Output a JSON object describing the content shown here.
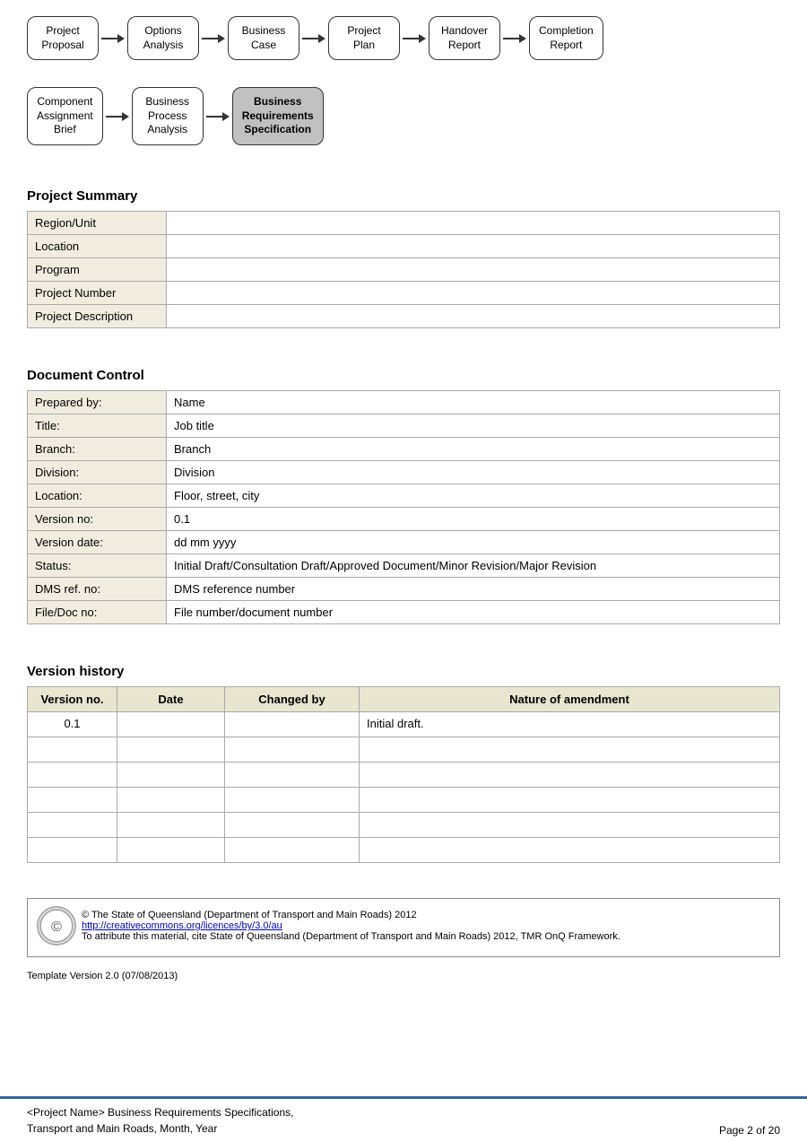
{
  "flow1": {
    "nodes": [
      {
        "label": "Project\nProposal",
        "active": false
      },
      {
        "label": "Options\nAnalysis",
        "active": false
      },
      {
        "label": "Business\nCase",
        "active": false
      },
      {
        "label": "Project\nPlan",
        "active": false
      },
      {
        "label": "Handover\nReport",
        "active": false
      },
      {
        "label": "Completion\nReport",
        "active": false
      }
    ]
  },
  "flow2": {
    "nodes": [
      {
        "label": "Component\nAssignment\nBrief",
        "active": false
      },
      {
        "label": "Business\nProcess\nAnalysis",
        "active": false
      },
      {
        "label": "Business\nRequirements\nSpecification",
        "active": true
      }
    ]
  },
  "projectSummary": {
    "title": "Project Summary",
    "rows": [
      {
        "label": "Region/Unit",
        "value": ""
      },
      {
        "label": "Location",
        "value": ""
      },
      {
        "label": "Program",
        "value": ""
      },
      {
        "label": "Project Number",
        "value": ""
      },
      {
        "label": "Project Description",
        "value": ""
      }
    ]
  },
  "documentControl": {
    "title": "Document Control",
    "rows": [
      {
        "label": "Prepared by:",
        "value": "Name"
      },
      {
        "label": "Title:",
        "value": "Job title"
      },
      {
        "label": "Branch:",
        "value": "Branch"
      },
      {
        "label": "Division:",
        "value": "Division"
      },
      {
        "label": "Location:",
        "value": "Floor, street, city"
      },
      {
        "label": "Version no:",
        "value": "0.1"
      },
      {
        "label": "Version date:",
        "value": "dd mm yyyy"
      },
      {
        "label": "Status:",
        "value": "Initial Draft/Consultation Draft/Approved Document/Minor Revision/Major Revision"
      },
      {
        "label": "DMS ref. no:",
        "value": "DMS reference number"
      },
      {
        "label": "File/Doc no:",
        "value": "File number/document number"
      }
    ]
  },
  "versionHistory": {
    "title": "Version history",
    "headers": [
      "Version no.",
      "Date",
      "Changed by",
      "Nature of amendment"
    ],
    "rows": [
      {
        "version": "0.1",
        "date": "",
        "changedBy": "",
        "nature": "Initial draft."
      },
      {
        "version": "",
        "date": "",
        "changedBy": "",
        "nature": ""
      },
      {
        "version": "",
        "date": "",
        "changedBy": "",
        "nature": ""
      },
      {
        "version": "",
        "date": "",
        "changedBy": "",
        "nature": ""
      },
      {
        "version": "",
        "date": "",
        "changedBy": "",
        "nature": ""
      },
      {
        "version": "",
        "date": "",
        "changedBy": "",
        "nature": ""
      }
    ]
  },
  "footer": {
    "copyright": "© The State of Queensland (Department of Transport and Main Roads) 2012",
    "link": "http://creativecommons.org/licences/by/3.0/au",
    "attribution": "To attribute this material, cite State of Queensland (Department of Transport and Main Roads) 2012, TMR OnQ Framework.",
    "templateVersion": "Template Version 2.0 (07/08/2013)"
  },
  "pageFooter": {
    "line1": "<Project Name> Business Requirements Specifications,",
    "line2": "Transport and Main Roads, Month, Year",
    "pageInfo": "Page 2 of 20"
  }
}
